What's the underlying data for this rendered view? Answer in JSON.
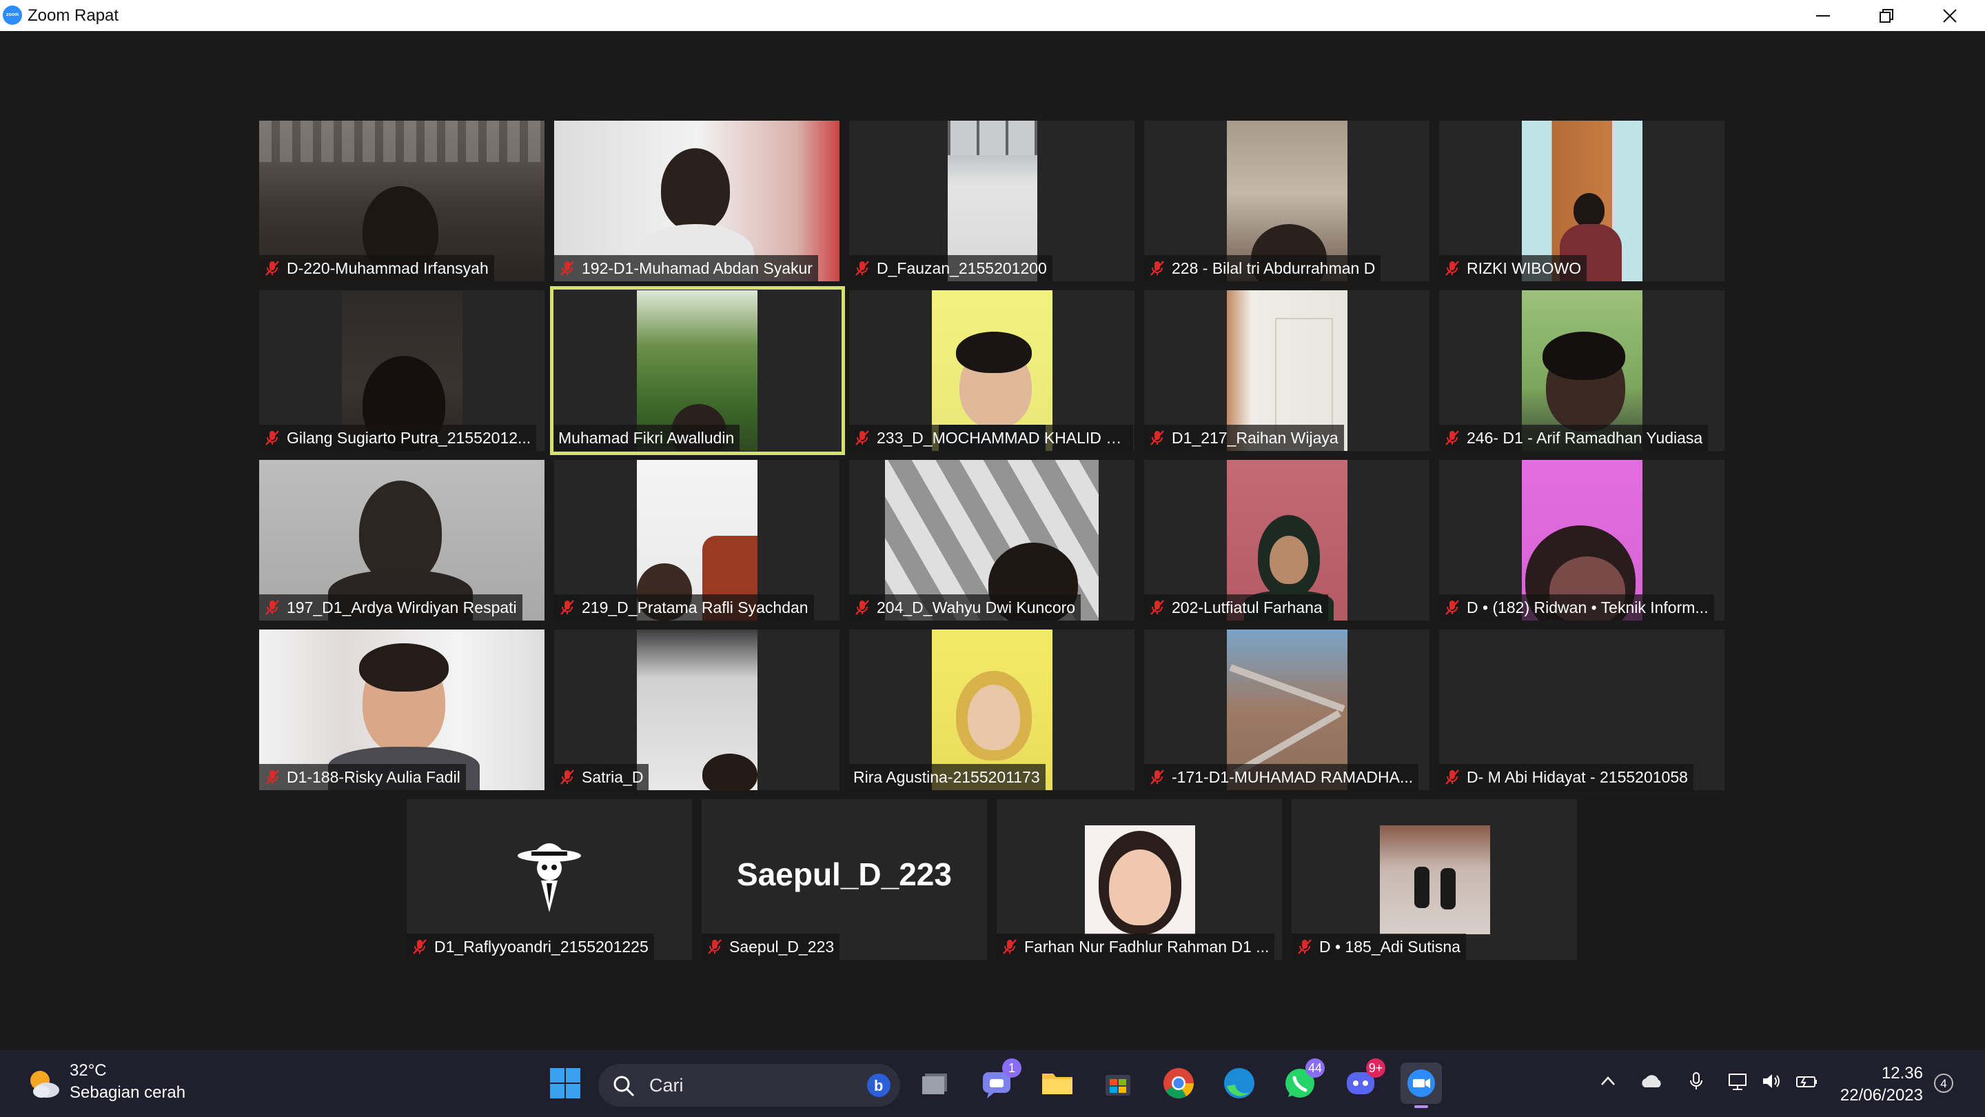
{
  "window": {
    "title": "Zoom Rapat"
  },
  "gallery": {
    "row1": [
      {
        "name": "D-220-Muhammad Irfansyah",
        "muted": true
      },
      {
        "name": "192-D1-Muhamad Abdan Syakur",
        "muted": true
      },
      {
        "name": "D_Fauzan_2155201200",
        "muted": true
      },
      {
        "name": "228 - Bilal tri Abdurrahman D",
        "muted": true
      },
      {
        "name": "RIZKI WIBOWO",
        "muted": true
      }
    ],
    "row2": [
      {
        "name": "Gilang Sugiarto Putra_21552012...",
        "muted": true
      },
      {
        "name": "Muhamad Fikri Awalludin",
        "muted": false,
        "active_speaker": true
      },
      {
        "name": "233_D_MOCHAMMAD KHALID H...",
        "muted": true
      },
      {
        "name": "D1_217_Raihan Wijaya",
        "muted": true
      },
      {
        "name": "246- D1 - Arif Ramadhan Yudiasa",
        "muted": true
      }
    ],
    "row3": [
      {
        "name": "197_D1_Ardya Wirdiyan Respati",
        "muted": true
      },
      {
        "name": "219_D_Pratama Rafli Syachdan",
        "muted": true
      },
      {
        "name": "204_D_Wahyu Dwi Kuncoro",
        "muted": true
      },
      {
        "name": "202-Lutfiatul Farhana",
        "muted": true
      },
      {
        "name": "D • (182) Ridwan • Teknik Inform...",
        "muted": true
      }
    ],
    "row4": [
      {
        "name": "D1-188-Risky Aulia Fadil",
        "muted": true
      },
      {
        "name": "Satria_D",
        "muted": true
      },
      {
        "name": "Rira Agustina-2155201173",
        "muted": false
      },
      {
        "name": "-171-D1-MUHAMAD RAMADHA...",
        "muted": true
      },
      {
        "name": "D- M Abi Hidayat - 2155201058",
        "muted": true
      }
    ],
    "row5": [
      {
        "name": "D1_Raflyyoandri_2155201225",
        "muted": true
      },
      {
        "name": "Saepul_D_223",
        "muted": true,
        "display_text": "Saepul_D_223"
      },
      {
        "name": "Farhan Nur Fadhlur Rahman D1 ...",
        "muted": true
      },
      {
        "name": "D • 185_Adi Sutisna",
        "muted": true
      }
    ],
    "active_speaker_color": "#d4e26b",
    "muted_icon_color": "#e02828"
  },
  "taskbar": {
    "weather": {
      "temp": "32°C",
      "condition": "Sebagian cerah",
      "icon": "partly-sunny-icon"
    },
    "search_label": "Cari",
    "badges": {
      "teams": "1",
      "whatsapp": "44",
      "discord": "9+"
    },
    "time": "12.36",
    "date": "22/06/2023",
    "notifications": "4"
  }
}
